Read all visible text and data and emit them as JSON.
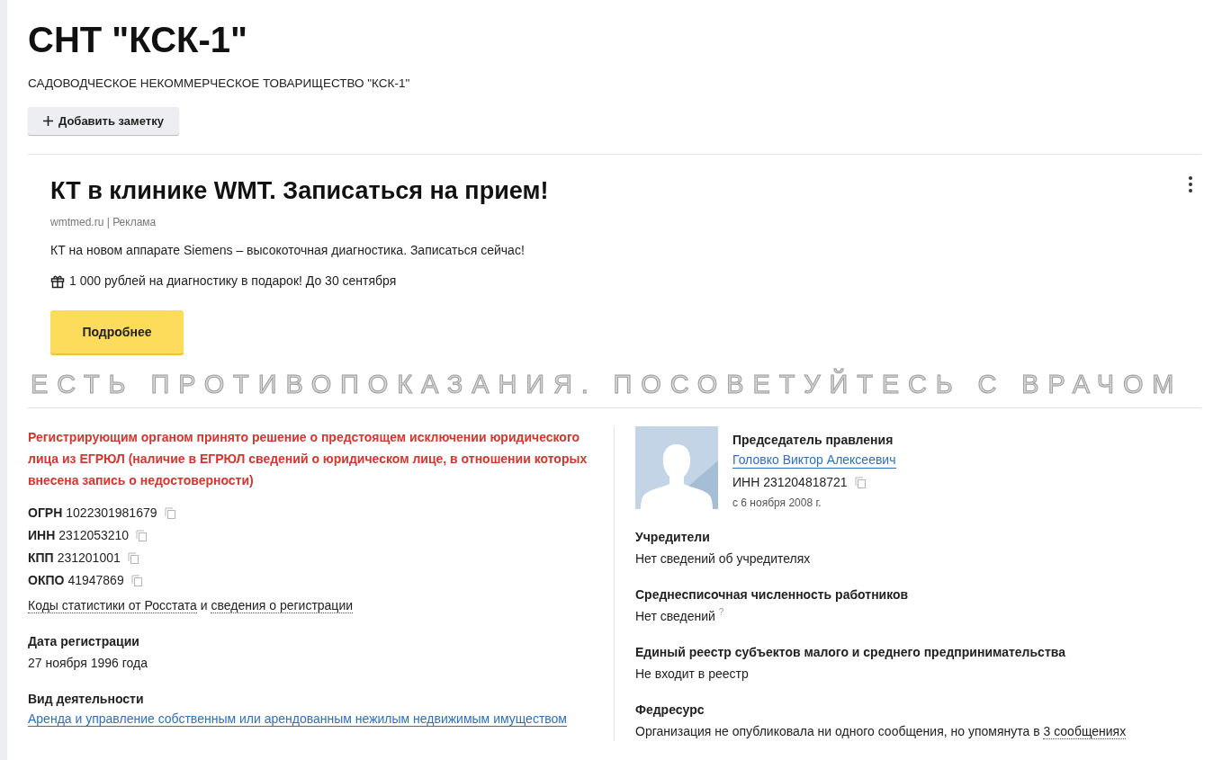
{
  "header": {
    "title": "СНТ \"КСК-1\"",
    "full_name": "САДОВОДЧЕСКОЕ НЕКОММЕРЧЕСКОЕ ТОВАРИЩЕСТВО \"КСК-1\"",
    "add_note_button": "Добавить заметку"
  },
  "ad": {
    "title": "КТ в клинике WMT. Записаться на прием!",
    "source": "wmtmed.ru | Реклама",
    "text": "КТ на новом аппарате Siemens – высокоточная диагностика. Записаться сейчас!",
    "promo": "1 000 рублей на диагностику в подарок! До 30 сентября",
    "button": "Подробнее",
    "disclaimer": "ЕСТЬ ПРОТИВОПОКАЗАНИЯ. ПОСОВЕТУЙТЕСЬ С ВРАЧОМ"
  },
  "warning": "Регистрирующим органом принято решение о предстоящем исключении юридического лица из ЕГРЮЛ (наличие в ЕГРЮЛ сведений о юридическом лице, в отношении которых внесена запись о недостоверности)",
  "codes": [
    {
      "label": "ОГРН",
      "value": "1022301981679"
    },
    {
      "label": "ИНН",
      "value": "2312053210"
    },
    {
      "label": "КПП",
      "value": "231201001"
    },
    {
      "label": "ОКПО",
      "value": "41947869"
    }
  ],
  "codes_links": {
    "first": "Коды статистики от Росстата",
    "joiner": "и",
    "second": "сведения о регистрации"
  },
  "left_sections": [
    {
      "kind": "text",
      "heading": "Дата регистрации",
      "value": "27 ноября 1996 года"
    },
    {
      "kind": "link",
      "heading": "Вид деятельности",
      "value": "Аренда и управление собственным или арендованным нежилым недвижимым имуществом"
    }
  ],
  "director": {
    "role": "Председатель правления",
    "name": "Головко Виктор Алексеевич",
    "inn": "ИНН 231204818721",
    "since": "с 6 ноября 2008 г."
  },
  "right_sections": [
    {
      "kind": "text",
      "heading": "Учредители",
      "value": "Нет сведений об учредителях"
    },
    {
      "kind": "help",
      "heading": "Среднесписочная численность работников",
      "value": "Нет сведений",
      "help": "?"
    },
    {
      "kind": "text",
      "heading": "Единый реестр субъектов малого и среднего предпринимательства",
      "value": "Не входит в реестр"
    },
    {
      "kind": "text_link",
      "heading": "Федресурс",
      "value": "Организация не опубликовала ни одного сообщения, но упомянута в",
      "link": "3 сообщениях"
    }
  ]
}
